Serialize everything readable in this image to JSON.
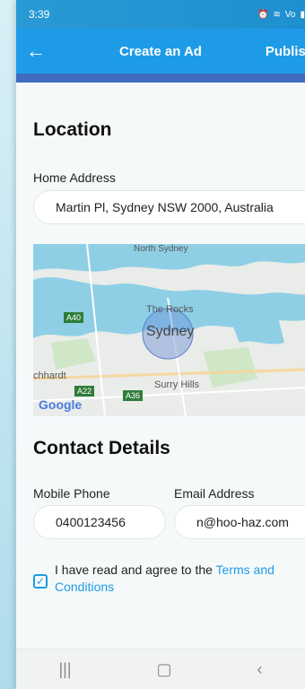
{
  "status_bar": {
    "time": "3:39",
    "icons": [
      "alarm-icon",
      "wifi-icon",
      "volte-icon",
      "signal-icon",
      "battery-icon"
    ]
  },
  "app_bar": {
    "back_icon": "arrow-left-icon",
    "title": "Create an Ad",
    "publish_label": "Publish"
  },
  "location": {
    "heading": "Location",
    "home_address_label": "Home Address",
    "home_address_value": "Martin Pl, Sydney NSW 2000, Australia"
  },
  "map": {
    "labels": {
      "north_sydney": "North Sydney",
      "the_rocks": "The Rocks",
      "sydney": "Sydney",
      "surry_hills": "Surry Hills",
      "leichhardt": "chhardt",
      "google": "Google",
      "a40": "A40",
      "a22": "A22",
      "a36": "A36"
    }
  },
  "contact": {
    "heading": "Contact Details",
    "mobile_label": "Mobile Phone",
    "mobile_value": "0400123456",
    "email_label": "Email Address",
    "email_value": "n@hoo-haz.com"
  },
  "agreement": {
    "checked": true,
    "text": "I have read and agree to the ",
    "link_text_1": "Terms and",
    "link_text_2": "Conditions"
  },
  "nav_bar": {
    "recents_icon": "recents-icon",
    "home_icon": "home-icon",
    "back_icon": "back-icon"
  },
  "colors": {
    "primary": "#1e9be6",
    "status_bar": "#1f8fc9",
    "accent_bar": "#3f6cc0"
  }
}
